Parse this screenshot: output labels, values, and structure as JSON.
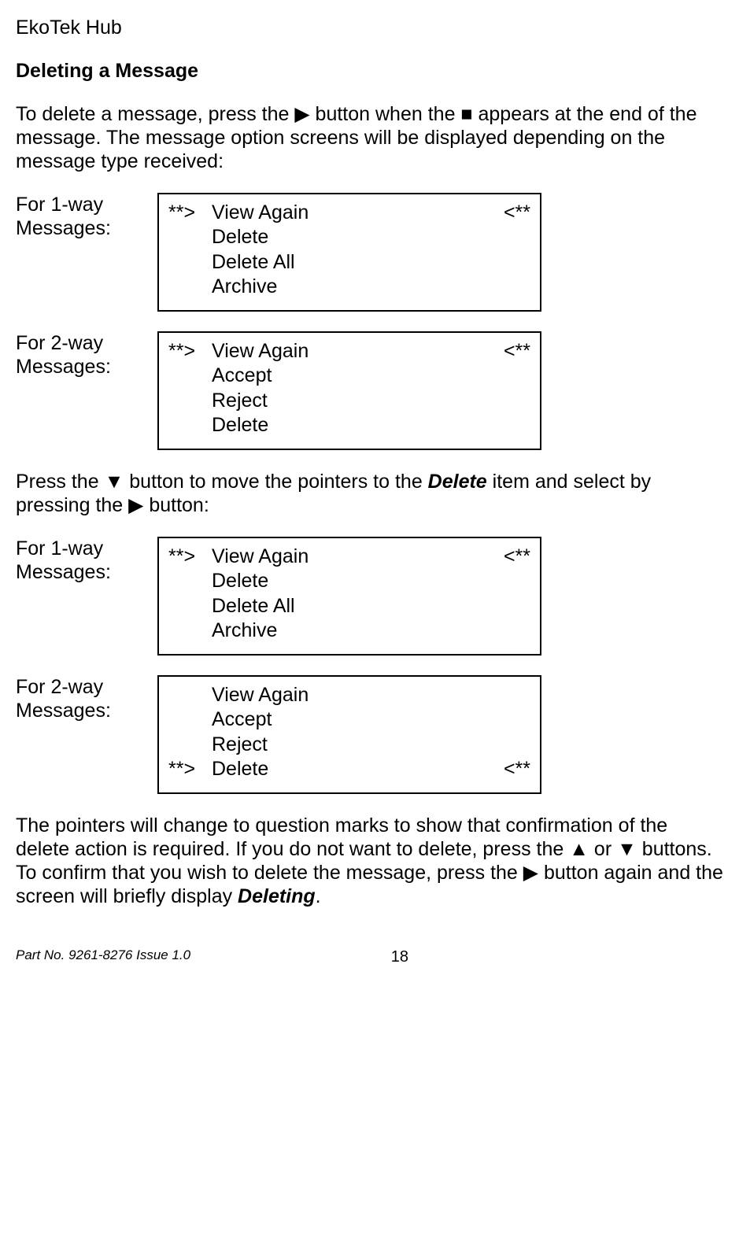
{
  "header": "EkoTek Hub",
  "heading": "Deleting a Message",
  "para1_a": "To delete a message, press the ",
  "para1_b": " button when the ",
  "para1_c": " appears at the end of the message.  The message option screens will be displayed depending on the message type received:",
  "label_1way": "For 1-way Messages:",
  "label_2way": "For 2-way Messages:",
  "pointer_left": "**>",
  "pointer_right": "<**",
  "screen1": {
    "lines": [
      "View Again",
      "Delete",
      "Delete All",
      "Archive"
    ],
    "selected": 0
  },
  "screen2": {
    "lines": [
      "View Again",
      "Accept",
      "Reject",
      "Delete"
    ],
    "selected": 0
  },
  "para2_a": "Press the ",
  "para2_b": " button to move the pointers to the ",
  "para2_delete": "Delete",
  "para2_c": " item and select by pressing the ",
  "para2_d": " button:",
  "screen3": {
    "lines": [
      "View Again",
      "Delete",
      "Delete All",
      "Archive"
    ],
    "selected": 0
  },
  "screen4": {
    "lines": [
      "View Again",
      "Accept",
      "Reject",
      "Delete"
    ],
    "selected": 3
  },
  "para3_a": "The pointers will change to question marks to show that confirmation of the delete action is required.  If you do not want to delete, press the ",
  "para3_b": " or ",
  "para3_c": " buttons.  To confirm that you wish to delete the message, press the ",
  "para3_d": " button again and the screen will briefly display ",
  "para3_deleting": "Deleting",
  "para3_e": ".",
  "footer_left": "Part No. 9261-8276  Issue 1.0",
  "footer_right": "18"
}
